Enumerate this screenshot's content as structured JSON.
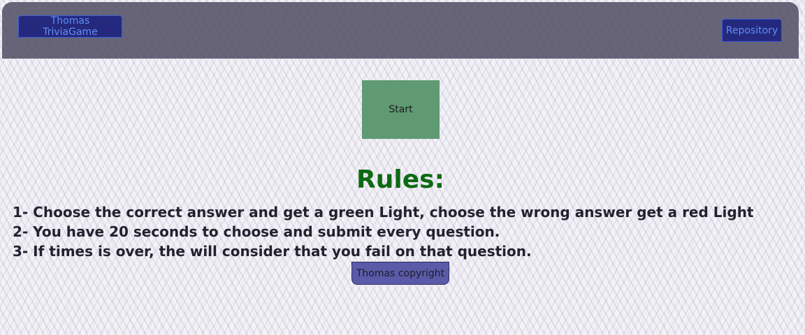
{
  "navbar": {
    "brand_label": "Thomas TriviaGame",
    "repository_label": "Repository"
  },
  "main": {
    "start_label": "Start",
    "rules_title": "Rules:",
    "rules": [
      "1- Choose the correct answer and get a green Light, choose the wrong answer get a red Light",
      "2- You have 20 seconds to choose and submit every question.",
      "3- If times is over, the will consider that you fail on that question."
    ]
  },
  "footer": {
    "copyright": "Thomas copyright"
  },
  "colors": {
    "navbar_bg": "#504e64",
    "nav_button_bg": "#24297e",
    "nav_button_text": "#5f8ff2",
    "start_button_bg": "#5f9a72",
    "rules_title": "#0d6a13",
    "footer_bg": "#5a5aa8"
  }
}
